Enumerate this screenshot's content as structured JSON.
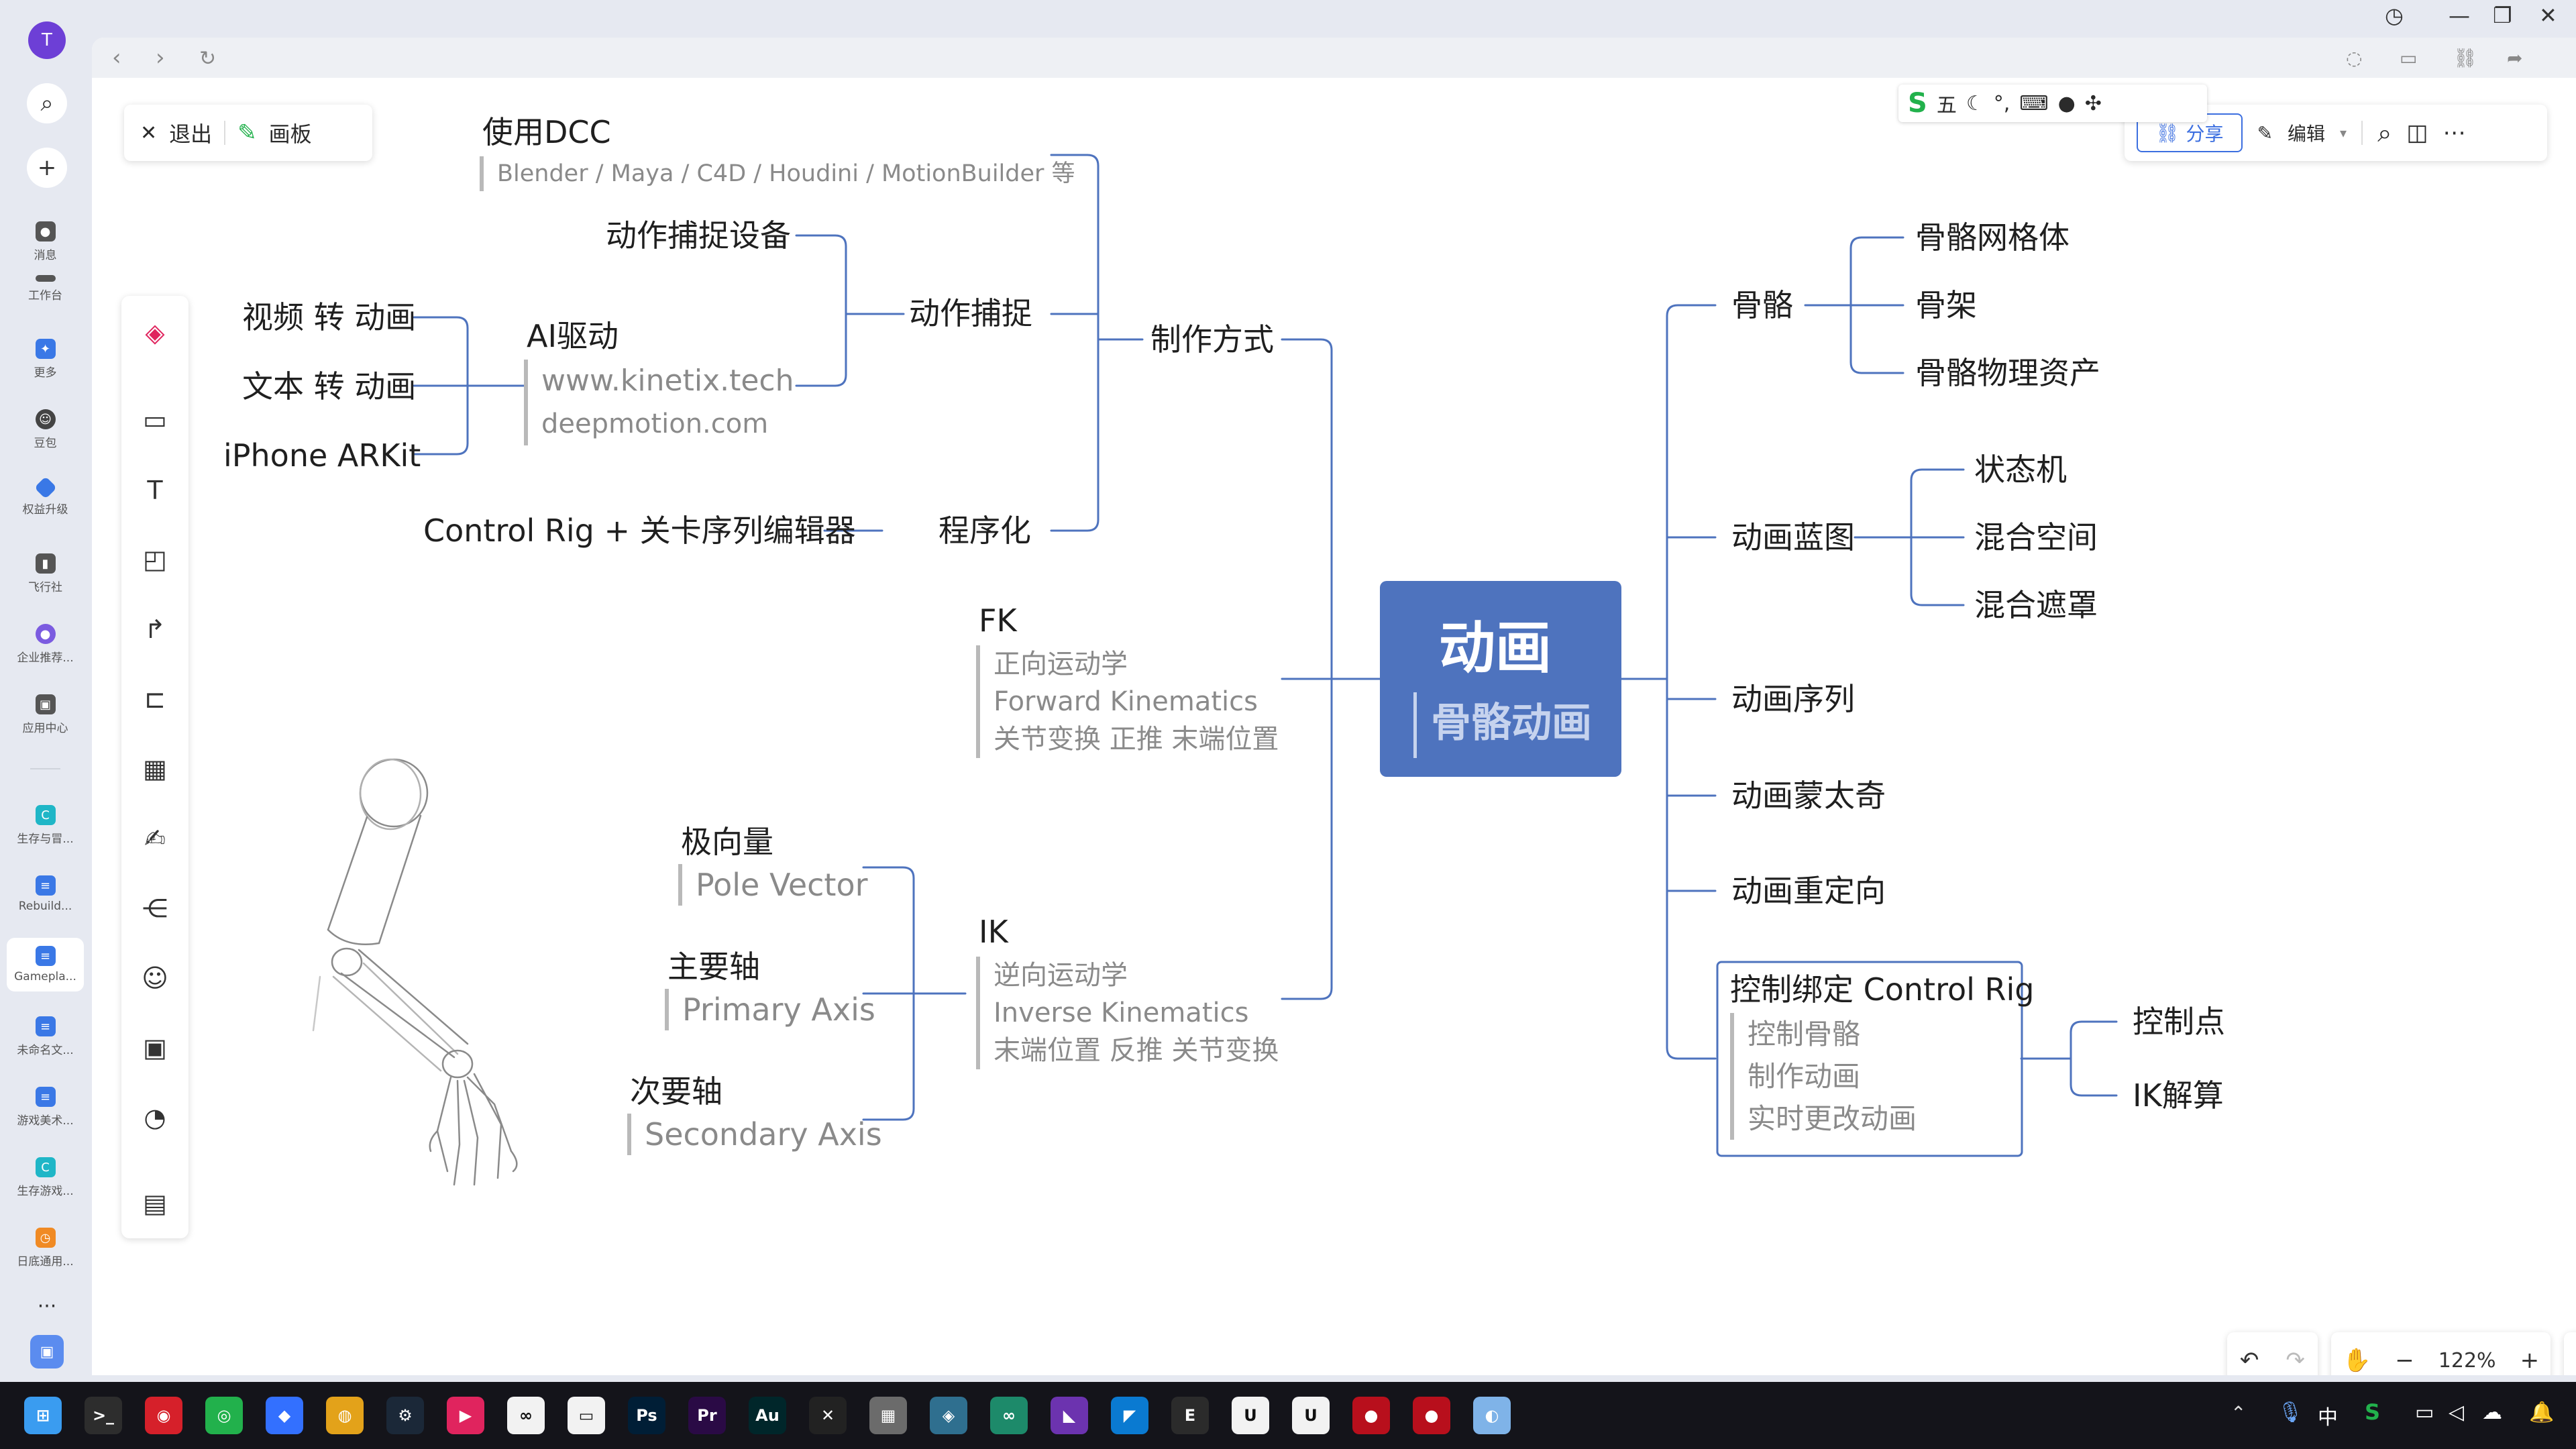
{
  "sidebar": {
    "avatar_letter": "T",
    "items": [
      {
        "label": "消息",
        "color": "#555555"
      },
      {
        "label": "工作台",
        "color": "#555555"
      },
      {
        "label": "更多",
        "color": "#3a78e6"
      },
      {
        "label": "豆包",
        "color": "#444444"
      },
      {
        "label": "权益升级",
        "color": "#3a78e6"
      },
      {
        "label": "飞行社",
        "color": "#555555"
      },
      {
        "label": "企业推荐...",
        "color": "#7b5be0"
      },
      {
        "label": "应用中心",
        "color": "#555555"
      },
      {
        "label": "生存与冒...",
        "color": "#1fb6c7"
      },
      {
        "label": "Rebuild...",
        "color": "#3a78e6"
      },
      {
        "label": "Gamepla...",
        "color": "#3a78e6"
      },
      {
        "label": "未命名文...",
        "color": "#3a78e6"
      },
      {
        "label": "游戏美术...",
        "color": "#3a78e6"
      },
      {
        "label": "生存游戏...",
        "color": "#1fb6c7"
      },
      {
        "label": "日底通用...",
        "color": "#f08a24"
      }
    ]
  },
  "toolbar": {
    "exit_label": "退出",
    "board_label": "画板",
    "share_label": "分享",
    "edit_label": "编辑",
    "zoom_level": "122%"
  },
  "ime": {
    "mode": "五"
  },
  "mindmap": {
    "root_title": "动画",
    "root_subtitle": "骨骼动画",
    "left": {
      "production": {
        "label": "制作方式",
        "dcc": {
          "label": "使用DCC",
          "note": "Blender / Maya / C4D / Houdini / MotionBuilder 等"
        },
        "mocap": {
          "label": "动作捕捉",
          "device": "动作捕捉设备",
          "ai": {
            "label": "AI驱动",
            "sites": [
              "www.kinetix.tech",
              "deepmotion.com"
            ],
            "sources": [
              "视频 转 动画",
              "文本 转 动画",
              "iPhone ARKit"
            ]
          }
        },
        "procedural": {
          "label": "程序化",
          "detail": "Control Rig + 关卡序列编辑器"
        }
      },
      "fk": {
        "label": "FK",
        "lines": [
          "正向运动学",
          "Forward Kinematics",
          "关节变换 正推 末端位置"
        ]
      },
      "ik": {
        "label": "IK",
        "lines": [
          "逆向运动学",
          "Inverse Kinematics",
          "末端位置 反推 关节变换"
        ],
        "children": [
          {
            "label": "极向量",
            "note": "Pole Vector"
          },
          {
            "label": "主要轴",
            "note": "Primary Axis"
          },
          {
            "label": "次要轴",
            "note": "Secondary Axis"
          }
        ]
      }
    },
    "right": {
      "skeleton": {
        "label": "骨骼",
        "children": [
          "骨骼网格体",
          "骨架",
          "骨骼物理资产"
        ]
      },
      "blueprint": {
        "label": "动画蓝图",
        "children": [
          "状态机",
          "混合空间",
          "混合遮罩"
        ]
      },
      "sequence": "动画序列",
      "montage": "动画蒙太奇",
      "retarget": "动画重定向",
      "controlrig": {
        "label": "控制绑定 Control Rig",
        "lines": [
          "控制骨骼",
          "制作动画",
          "实时更改动画"
        ],
        "children": [
          "控制点",
          "IK解算"
        ]
      }
    }
  },
  "taskbar": {
    "icons": [
      {
        "name": "windows-start-icon",
        "glyph": "⊞",
        "color": "#3a9cf0"
      },
      {
        "name": "terminal-icon",
        "glyph": ">_",
        "color": "#2d2d2d"
      },
      {
        "name": "netease-music-icon",
        "glyph": "◉",
        "color": "#d6202a"
      },
      {
        "name": "wechat-icon",
        "glyph": "◎",
        "color": "#22b14c"
      },
      {
        "name": "feishu-icon",
        "glyph": "◆",
        "color": "#3370ff"
      },
      {
        "name": "chrome-icon",
        "glyph": "◍",
        "color": "#e3a21a"
      },
      {
        "name": "steam-icon",
        "glyph": "⚙",
        "color": "#1b2838"
      },
      {
        "name": "app-red-icon",
        "glyph": "▶",
        "color": "#e0245e"
      },
      {
        "name": "meta-icon",
        "glyph": "∞",
        "color": "#f2f2f2"
      },
      {
        "name": "vr-icon",
        "glyph": "▭",
        "color": "#f2f2f2"
      },
      {
        "name": "photoshop-icon",
        "glyph": "Ps",
        "color": "#001e36"
      },
      {
        "name": "premiere-icon",
        "glyph": "Pr",
        "color": "#2a0a45"
      },
      {
        "name": "audition-icon",
        "glyph": "Au",
        "color": "#00262a"
      },
      {
        "name": "capcut-icon",
        "glyph": "✕",
        "color": "#222222"
      },
      {
        "name": "calculator-icon",
        "glyph": "▦",
        "color": "#6b6b6b"
      },
      {
        "name": "map-app-icon",
        "glyph": "◈",
        "color": "#2f6f8f"
      },
      {
        "name": "app-green-icon",
        "glyph": "∞",
        "color": "#1d8a6a"
      },
      {
        "name": "visual-studio-icon",
        "glyph": "◣",
        "color": "#6c33af"
      },
      {
        "name": "vscode-icon",
        "glyph": "◤",
        "color": "#0a7ad1"
      },
      {
        "name": "epic-games-icon",
        "glyph": "E",
        "color": "#2b2b2b"
      },
      {
        "name": "unreal-icon-1",
        "glyph": "U",
        "color": "#f2f2f2"
      },
      {
        "name": "unreal-icon-2",
        "glyph": "U",
        "color": "#f2f2f2"
      },
      {
        "name": "record-icon-1",
        "glyph": "●",
        "color": "#b80f1c"
      },
      {
        "name": "record-icon-2",
        "glyph": "●",
        "color": "#b80f1c"
      },
      {
        "name": "app-gradient-icon",
        "glyph": "◐",
        "color": "#7fb3e8"
      }
    ],
    "tray_lang": "中"
  },
  "colors": {
    "accent": "#4e73be",
    "connector": "#4e73be",
    "note_bar": "#b9b9b9"
  }
}
